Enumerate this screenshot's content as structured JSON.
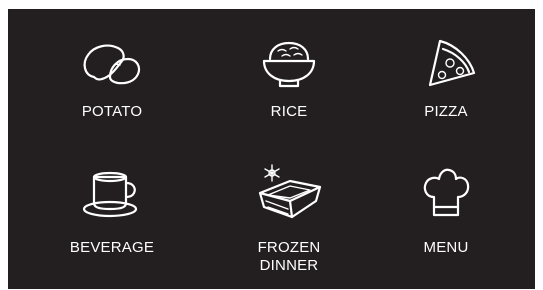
{
  "colors": {
    "background": "#231f20",
    "foreground": "#ffffff"
  },
  "menu": {
    "items": [
      {
        "label": "POTATO",
        "icon": "potato-icon"
      },
      {
        "label": "RICE",
        "icon": "rice-bowl-icon"
      },
      {
        "label": "PIZZA",
        "icon": "pizza-slice-icon"
      },
      {
        "label": "BEVERAGE",
        "icon": "coffee-cup-icon"
      },
      {
        "label": "FROZEN\nDINNER",
        "icon": "frozen-dinner-icon"
      },
      {
        "label": "MENU",
        "icon": "chef-hat-icon"
      }
    ]
  }
}
